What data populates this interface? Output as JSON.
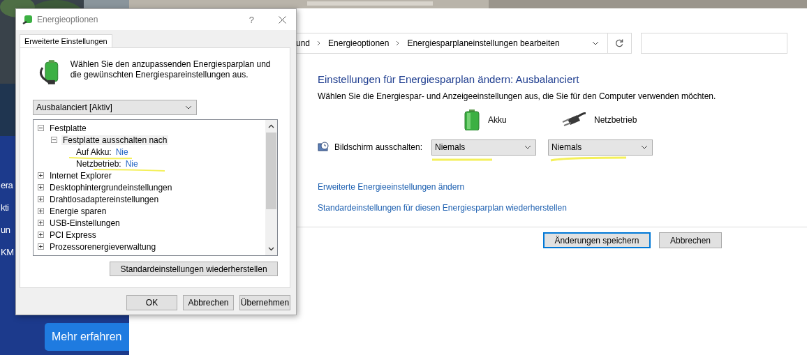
{
  "ad": {
    "lines": [
      "era",
      "kti",
      "un",
      "KM"
    ],
    "button": "Mehr erfahren"
  },
  "dialog": {
    "title": "Energieoptionen",
    "help": "?",
    "tabs": [
      {
        "label": "Erweiterte Einstellungen",
        "selected": true
      }
    ],
    "intro": "Wählen Sie den anzupassenden Energiesparplan und die gewünschten Energiespareinstellungen aus.",
    "plan_select": {
      "value": "Ausbalanciert [Aktiv]"
    },
    "tree": [
      {
        "label": "Festplatte",
        "expanded": true,
        "selected": false,
        "children": [
          {
            "label": "Festplatte ausschalten nach",
            "expanded": true,
            "selected": true,
            "children": [
              {
                "label": "Auf Akku:",
                "value": "Nie",
                "selected": false
              },
              {
                "label": "Netzbetrieb:",
                "value": "Nie",
                "selected": false
              }
            ]
          }
        ]
      },
      {
        "label": "Internet Explorer",
        "expanded": false,
        "selected": false
      },
      {
        "label": "Desktophintergrundeinstellungen",
        "expanded": false,
        "selected": false
      },
      {
        "label": "Drahtlosadaptereinstellungen",
        "expanded": false,
        "selected": false
      },
      {
        "label": "Energie sparen",
        "expanded": false,
        "selected": false
      },
      {
        "label": "USB-Einstellungen",
        "expanded": false,
        "selected": false
      },
      {
        "label": "PCI Express",
        "expanded": false,
        "selected": false
      },
      {
        "label": "Prozessorenergieverwaltung",
        "expanded": false,
        "selected": false
      }
    ],
    "restore_button": "Standardeinstellungen wiederherstellen",
    "buttons": [
      "OK",
      "Abbrechen",
      "Übernehmen"
    ]
  },
  "control_panel": {
    "breadcrumb": [
      "und",
      "Energieoptionen",
      "Energiesparplaneinstellungen bearbeiten"
    ],
    "heading": "Einstellungen für Energiesparplan ändern: Ausbalanciert",
    "description": "Wählen Sie die Energiespar- und Anzeigeeinstellungen aus, die Sie für den Computer verwenden möchten.",
    "columns": [
      {
        "kind": "battery",
        "label": "Akku"
      },
      {
        "kind": "plug",
        "label": "Netzbetrieb"
      }
    ],
    "settings": [
      {
        "label": "Bildschirm ausschalten:",
        "values": [
          "Niemals",
          "Niemals"
        ]
      }
    ],
    "links": [
      "Erweiterte Energieeinstellungen ändern",
      "Standardeinstellungen für diesen Energiesparplan wiederherstellen"
    ],
    "buttons": [
      {
        "label": "Änderungen speichern",
        "default": true
      },
      {
        "label": "Abbrechen",
        "default": false
      }
    ]
  }
}
